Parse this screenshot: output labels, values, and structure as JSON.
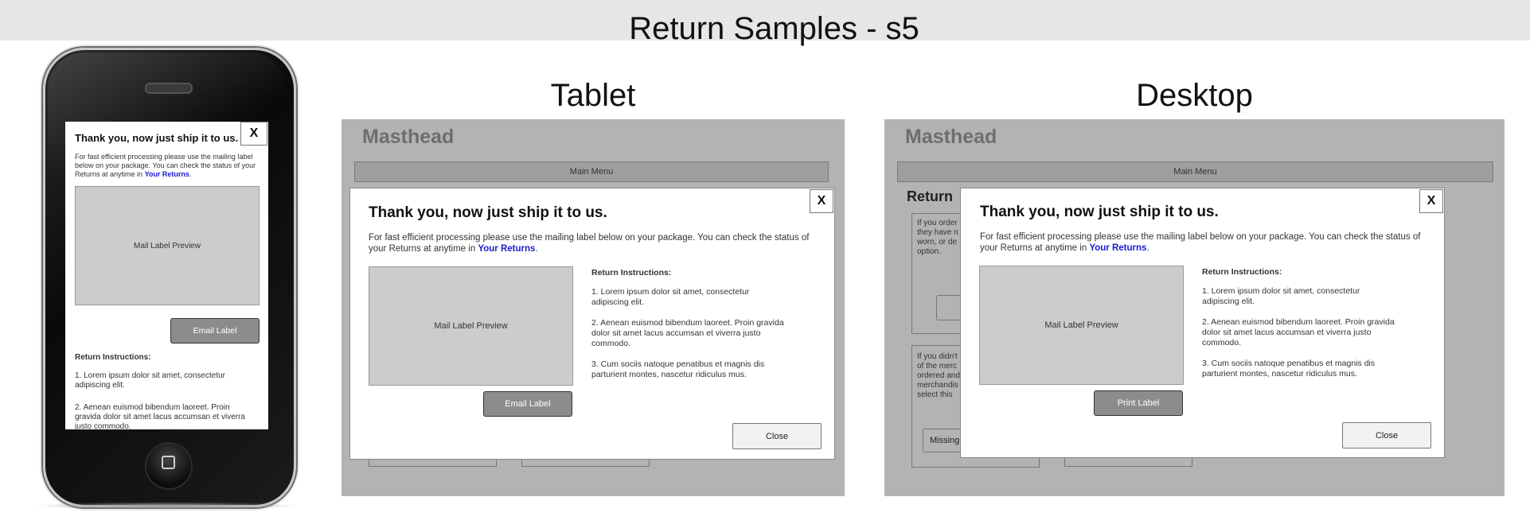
{
  "header": {
    "title": "Return Samples - s5"
  },
  "sections": {
    "tablet": "Tablet",
    "desktop": "Desktop"
  },
  "modal": {
    "title": "Thank you, now just ship it to us.",
    "body": "For fast efficient processing please use the mailing label below on your package. You can check the status of your Returns at anytime in",
    "body_mobile": "For fast efficient processing please use the mailing label below on your package. You can check the status of your Returns at anytime in",
    "link": "Your Returns",
    "link_suffix": ".",
    "close_x": "X",
    "preview": "Mail Label Preview",
    "email_label": "Email Label",
    "print_label": "Print Label",
    "close": "Close",
    "instructions_heading": "Return Instructions:",
    "instructions": [
      "1. Lorem ipsum dolor sit amet, consectetur adipiscing elit.",
      "2. Aenean euismod bibendum laoreet. Proin gravida dolor sit amet lacus accumsan et viverra justo commodo.",
      "3. Cum sociis natoque penatibus et magnis dis parturient montes, nascetur ridiculus mus."
    ]
  },
  "frame": {
    "masthead": "Masthead",
    "main_menu": "Main Menu"
  },
  "desktop_background": {
    "heading": "Return",
    "box1_text": [
      "If you order",
      "they have n",
      "worn, or de",
      "option."
    ],
    "box2_text": [
      "If you didn't",
      "of the merc",
      "ordered and",
      "merchandis",
      "select this"
    ],
    "missing_button": "Missing"
  }
}
